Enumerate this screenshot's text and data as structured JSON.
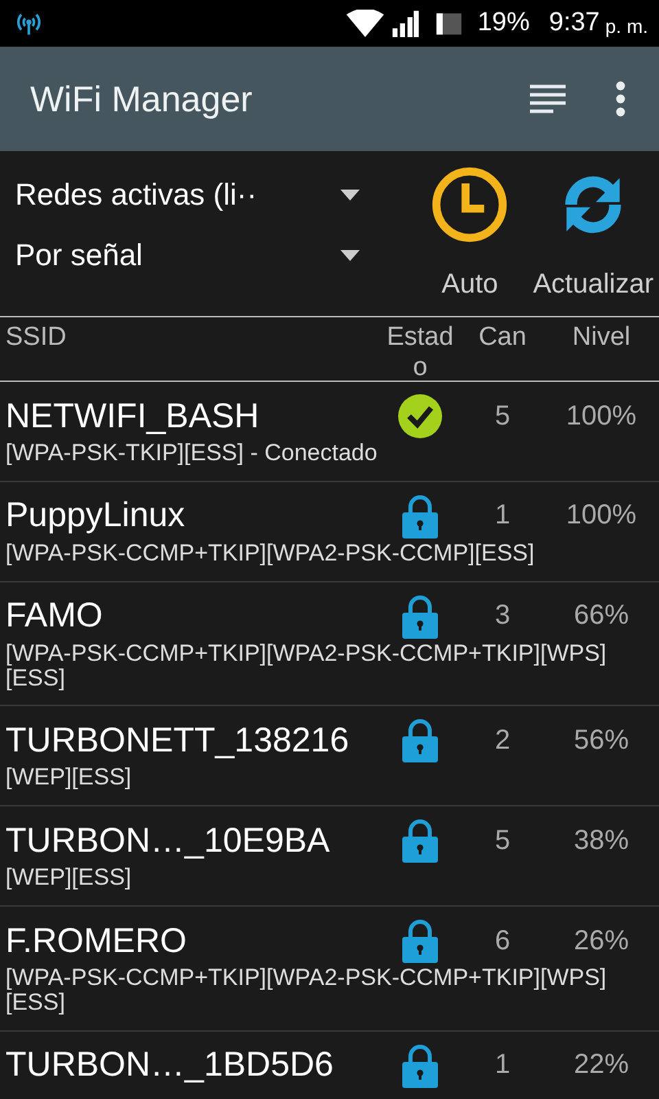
{
  "status_bar": {
    "battery": "19%",
    "time": "9:37",
    "ampm": "p. m."
  },
  "app_bar": {
    "title": "WiFi Manager"
  },
  "filters": [
    {
      "value": "Redes activas (li··"
    },
    {
      "value": "Por señal"
    }
  ],
  "actions": [
    {
      "kind": "auto",
      "label": "Auto"
    },
    {
      "kind": "refresh",
      "label": "Actualizar"
    }
  ],
  "columns": [
    "SSID",
    "Estado",
    "Can",
    "Nivel"
  ],
  "networks": [
    {
      "ssid": "NETWIFI_BASH",
      "security": "[WPA-PSK-TKIP][ESS] - Conectado",
      "kind": "connected",
      "channel": "5",
      "level": "100%"
    },
    {
      "ssid": "PuppyLinux",
      "security": "[WPA-PSK-CCMP+TKIP][WPA2-PSK-CCMP][ESS]",
      "kind": "locked",
      "channel": "1",
      "level": "100%"
    },
    {
      "ssid": "FAMO",
      "security": "[WPA-PSK-CCMP+TKIP][WPA2-PSK-CCMP+TKIP][WPS][ESS]",
      "kind": "locked",
      "channel": "3",
      "level": "66%"
    },
    {
      "ssid": "TURBONETT_138216",
      "security": "[WEP][ESS]",
      "kind": "locked",
      "channel": "2",
      "level": "56%"
    },
    {
      "ssid": "TURBON…_10E9BA",
      "security": "[WEP][ESS]",
      "kind": "locked",
      "channel": "5",
      "level": "38%"
    },
    {
      "ssid": "F.ROMERO",
      "security": "[WPA-PSK-CCMP+TKIP][WPA2-PSK-CCMP+TKIP][WPS][ESS]",
      "kind": "locked",
      "channel": "6",
      "level": "26%"
    },
    {
      "ssid": "TURBON…_1BD5D6",
      "kind": "locked",
      "channel": "1",
      "level": "22%"
    }
  ]
}
